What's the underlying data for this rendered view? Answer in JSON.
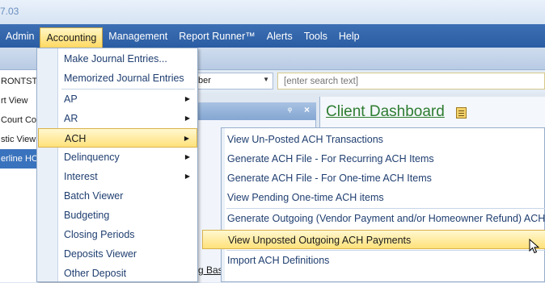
{
  "window": {
    "title_fragment": "7.03"
  },
  "menubar": {
    "items": [
      {
        "label": "Admin"
      },
      {
        "label": "Accounting"
      },
      {
        "label": "Management"
      },
      {
        "label": "Report Runner™"
      },
      {
        "label": "Alerts"
      },
      {
        "label": "Tools"
      },
      {
        "label": "Help"
      }
    ]
  },
  "search": {
    "dropdown_value": "ber",
    "placeholder": "[enter search text]"
  },
  "left_list": {
    "rows": [
      "RONTSTE",
      "rt View",
      "Court Cor",
      "stic View",
      "erline HOA"
    ]
  },
  "panel": {
    "pin_glyph": "ᵠ",
    "close_glyph": "×",
    "link_text": "g Basis"
  },
  "dashboard": {
    "title": "Client Dashboard",
    "icon": "clipboard-icon"
  },
  "accounting_menu": {
    "items": [
      {
        "label": "Make Journal Entries..."
      },
      {
        "label": "Memorized Journal Entries"
      },
      {
        "label": "AP",
        "submenu": true
      },
      {
        "label": "AR",
        "submenu": true
      },
      {
        "label": "ACH",
        "submenu": true
      },
      {
        "label": "Delinquency",
        "submenu": true
      },
      {
        "label": "Interest",
        "submenu": true
      },
      {
        "label": "Batch Viewer"
      },
      {
        "label": "Budgeting"
      },
      {
        "label": "Closing Periods"
      },
      {
        "label": "Deposits Viewer"
      },
      {
        "label": "Other Deposit"
      }
    ]
  },
  "ach_submenu": {
    "items": [
      {
        "label": "View Un-Posted ACH Transactions"
      },
      {
        "label": "Generate ACH File - For Recurring ACH Items"
      },
      {
        "label": "Generate ACH File - For One-time ACH Items"
      },
      {
        "label": "View Pending One-time ACH items"
      },
      {
        "label": "Generate Outgoing (Vendor Payment and/or Homeowner Refund) ACH File"
      },
      {
        "label": "View Unposted Outgoing ACH Payments"
      },
      {
        "label": "Import ACH Definitions"
      }
    ]
  },
  "colors": {
    "menubar": "#2a5da3",
    "highlight": "#ffe27a",
    "dashboard_title": "#2e7d32"
  }
}
